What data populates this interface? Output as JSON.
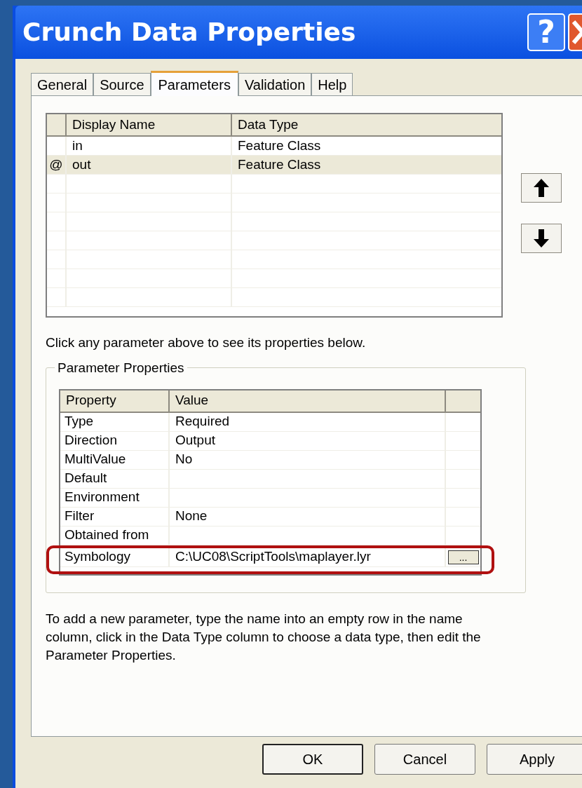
{
  "window": {
    "title": "Crunch Data Properties",
    "help_button": "?"
  },
  "tabs": [
    {
      "label": "General",
      "selected": false
    },
    {
      "label": "Source",
      "selected": false
    },
    {
      "label": "Parameters",
      "selected": true
    },
    {
      "label": "Validation",
      "selected": false
    },
    {
      "label": "Help",
      "selected": false
    }
  ],
  "parameters_table": {
    "columns": [
      "Display Name",
      "Data Type"
    ],
    "rows": [
      {
        "marker": "",
        "name": "in",
        "data_type": "Feature Class",
        "selected": false
      },
      {
        "marker": "@",
        "name": "out",
        "data_type": "Feature Class",
        "selected": true
      }
    ]
  },
  "hint": "Click any parameter above to see its properties below.",
  "parameter_properties": {
    "title": "Parameter Properties",
    "columns": [
      "Property",
      "Value"
    ],
    "rows": [
      {
        "property": "Type",
        "value": "Required",
        "highlighted": false
      },
      {
        "property": "Direction",
        "value": "Output",
        "highlighted": false
      },
      {
        "property": "MultiValue",
        "value": "No",
        "highlighted": false
      },
      {
        "property": "Default",
        "value": "",
        "highlighted": false
      },
      {
        "property": "Environment",
        "value": "",
        "highlighted": false
      },
      {
        "property": "Filter",
        "value": "None",
        "highlighted": false
      },
      {
        "property": "Obtained from",
        "value": "",
        "highlighted": false
      },
      {
        "property": "Symbology",
        "value": "C:\\UC08\\ScriptTools\\maplayer.lyr",
        "browse": "...",
        "highlighted": true
      }
    ]
  },
  "instructions": "To add a new parameter, type the name into an empty row in the name column, click in the Data Type column to choose a data type, then edit the Parameter Properties.",
  "buttons": [
    "OK",
    "Cancel",
    "Apply"
  ]
}
